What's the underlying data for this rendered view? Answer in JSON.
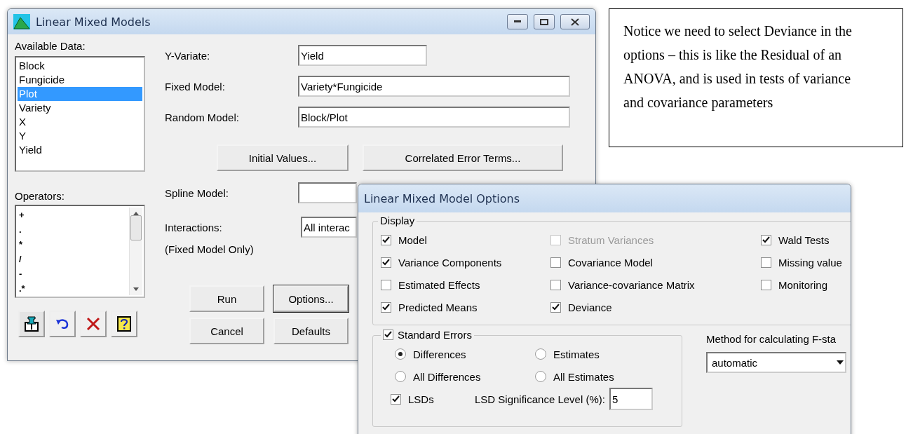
{
  "main_window": {
    "title": "Linear Mixed Models",
    "available_data": {
      "label": "Available Data:",
      "items": [
        {
          "label": "Block",
          "selected": false
        },
        {
          "label": "Fungicide",
          "selected": false
        },
        {
          "label": "Plot",
          "selected": true
        },
        {
          "label": "Variety",
          "selected": false
        },
        {
          "label": "X",
          "selected": false
        },
        {
          "label": "Y",
          "selected": false
        },
        {
          "label": "Yield",
          "selected": false
        }
      ]
    },
    "operators": {
      "label": "Operators:",
      "items": [
        "+",
        ".",
        "*",
        "/",
        "-",
        ".*"
      ]
    },
    "fields": [
      {
        "label": "Y-Variate:",
        "value": "Yield",
        "kind": "short"
      },
      {
        "label": "Fixed Model:",
        "value": "Variety*Fungicide",
        "kind": "long"
      },
      {
        "label": "Random Model:",
        "value": "Block/Plot",
        "kind": "long"
      }
    ],
    "model_buttons": [
      "Initial Values...",
      "Correlated Error Terms..."
    ],
    "spline": {
      "label": "Spline Model:"
    },
    "interactions": {
      "label": "Interactions:",
      "value": "All interac",
      "note": "(Fixed Model Only)"
    },
    "action_buttons": [
      {
        "label": "Run",
        "focused": false
      },
      {
        "label": "Options...",
        "focused": true
      },
      {
        "label": "Cancel",
        "focused": false
      },
      {
        "label": "Defaults",
        "focused": false
      }
    ]
  },
  "options_window": {
    "title": "Linear Mixed Model Options",
    "display": {
      "label": "Display",
      "options": [
        {
          "label": "Model",
          "checked": true,
          "disabled": false
        },
        {
          "label": "Stratum Variances",
          "checked": false,
          "disabled": true
        },
        {
          "label": "Wald Tests",
          "checked": true,
          "disabled": false
        },
        {
          "label": "Variance Components",
          "checked": true,
          "disabled": false
        },
        {
          "label": "Covariance Model",
          "checked": false,
          "disabled": false
        },
        {
          "label": "Missing value",
          "checked": false,
          "disabled": false
        },
        {
          "label": "Estimated Effects",
          "checked": false,
          "disabled": false
        },
        {
          "label": "Variance-covariance Matrix",
          "checked": false,
          "disabled": false
        },
        {
          "label": "Monitoring",
          "checked": false,
          "disabled": false
        },
        {
          "label": "Predicted Means",
          "checked": true,
          "disabled": false
        },
        {
          "label": "Deviance",
          "checked": true,
          "disabled": false
        }
      ]
    },
    "standard_errors": {
      "label": "Standard Errors",
      "checked": true,
      "choices": [
        {
          "label": "Differences",
          "selected": true
        },
        {
          "label": "Estimates",
          "selected": false
        },
        {
          "label": "All Differences",
          "selected": false
        },
        {
          "label": "All Estimates",
          "selected": false
        }
      ],
      "lsds": {
        "label": "LSDs",
        "checked": true
      },
      "lsd_level": {
        "label": "LSD Significance Level (%):",
        "value": "5"
      }
    },
    "method": {
      "label": "Method for calculating F-sta",
      "value": "automatic"
    }
  },
  "note": {
    "text": "Notice we need to select Deviance in the options – this is like the Residual of an ANOVA, and is used in tests of variance and covariance parameters"
  }
}
